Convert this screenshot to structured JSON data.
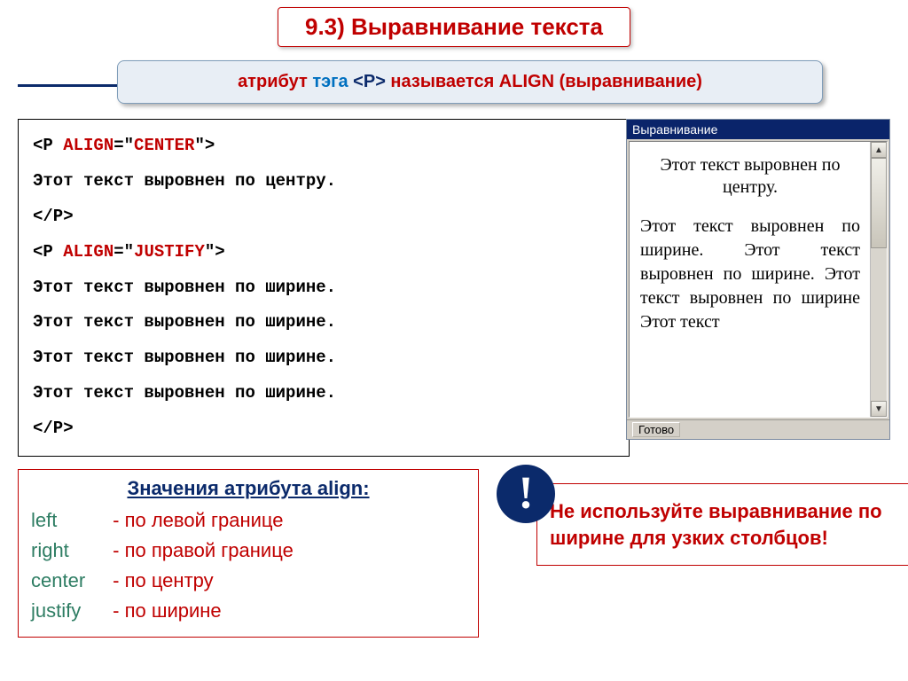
{
  "title": "9.3) Выравнивание текста",
  "subtitle": {
    "t1": "атрибут ",
    "t2": "тэга ",
    "t3": "<P>",
    "t4": " называется ",
    "t5": "ALIGN (выравнивание)"
  },
  "code": {
    "l1a": "<P ",
    "l1b": "ALIGN",
    "l1c": "=\"",
    "l1d": "CENTER",
    "l1e": "\">",
    "l2": "Этот текст выровнен по центру.",
    "l3": "</P>",
    "l4a": "<P ",
    "l4b": "ALIGN",
    "l4c": "=\"",
    "l4d": "JUSTIFY",
    "l4e": "\">",
    "l5": "Этот текст выровнен по ширине.",
    "l6": "Этот текст выровнен по ширине.",
    "l7": "Этот текст выровнен по ширине.",
    "l8": "Этот текст выровнен по ширине.",
    "l9": "</P>"
  },
  "browser": {
    "title": "Выравнивание",
    "centered": "Этот текст выровнен по центру.",
    "justified": "Этот текст выровнен по ширине. Этот текст выровнен по ширине. Этот текст выровнен по ширине Этот текст",
    "status": "Готово"
  },
  "values": {
    "title": "Значения атрибута align:",
    "rows": {
      "left_name": "left",
      "left_desc": "-  по левой границе",
      "right_name": "right",
      "right_desc": "-  по правой границе",
      "center_name": "center",
      "center_desc": "-  по центру",
      "justify_name": "justify",
      "justify_desc": "-  по ширине"
    }
  },
  "warning": "Не используйте выравнивание по ширине для узких столбцов!",
  "excl": "!"
}
